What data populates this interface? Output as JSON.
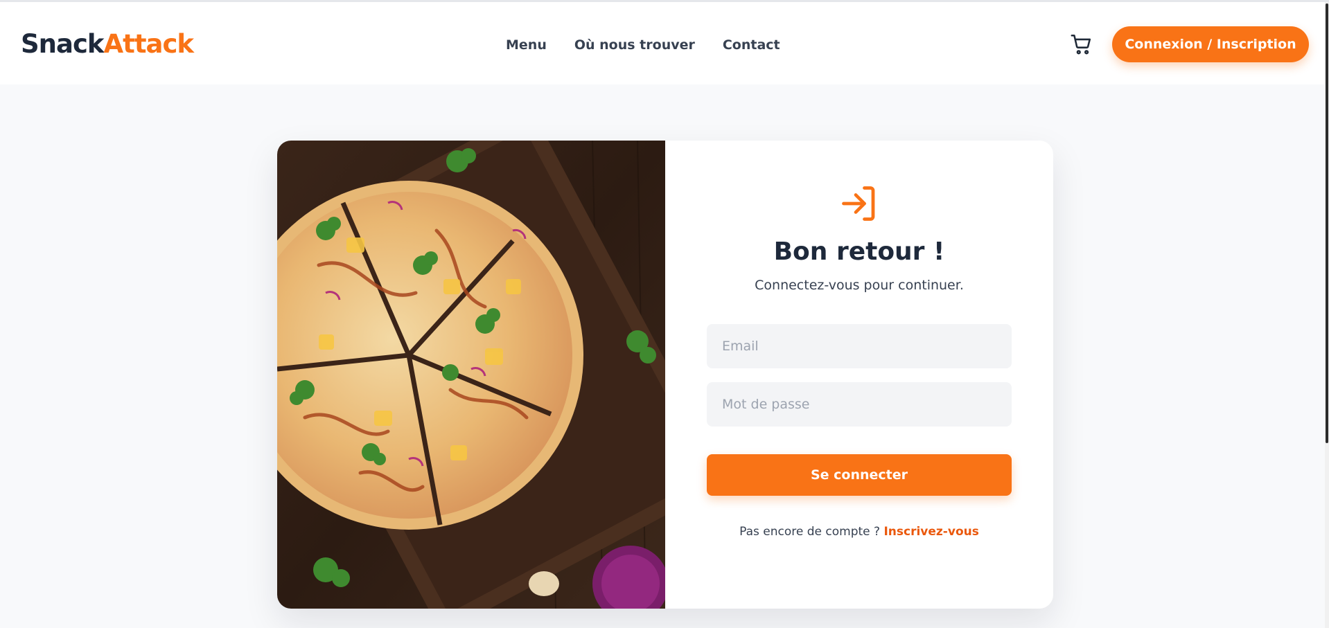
{
  "header": {
    "logo_part1": "Snack",
    "logo_part2": "Attack",
    "nav": [
      "Menu",
      "Où nous trouver",
      "Contact"
    ],
    "cart_icon": "shopping-cart-icon",
    "login_button": "Connexion / Inscription"
  },
  "login_card": {
    "icon": "log-in-icon",
    "title": "Bon retour !",
    "subtitle": "Connectez-vous pour continuer.",
    "email_placeholder": "Email",
    "password_placeholder": "Mot de passe",
    "submit_label": "Se connecter",
    "signup_text": "Pas encore de compte ?",
    "signup_link": "Inscrivez-vous"
  },
  "colors": {
    "accent": "#f97316",
    "logo_dark": "#1e293b",
    "page_bg": "#f8f9fb",
    "input_bg": "#f3f4f6"
  }
}
